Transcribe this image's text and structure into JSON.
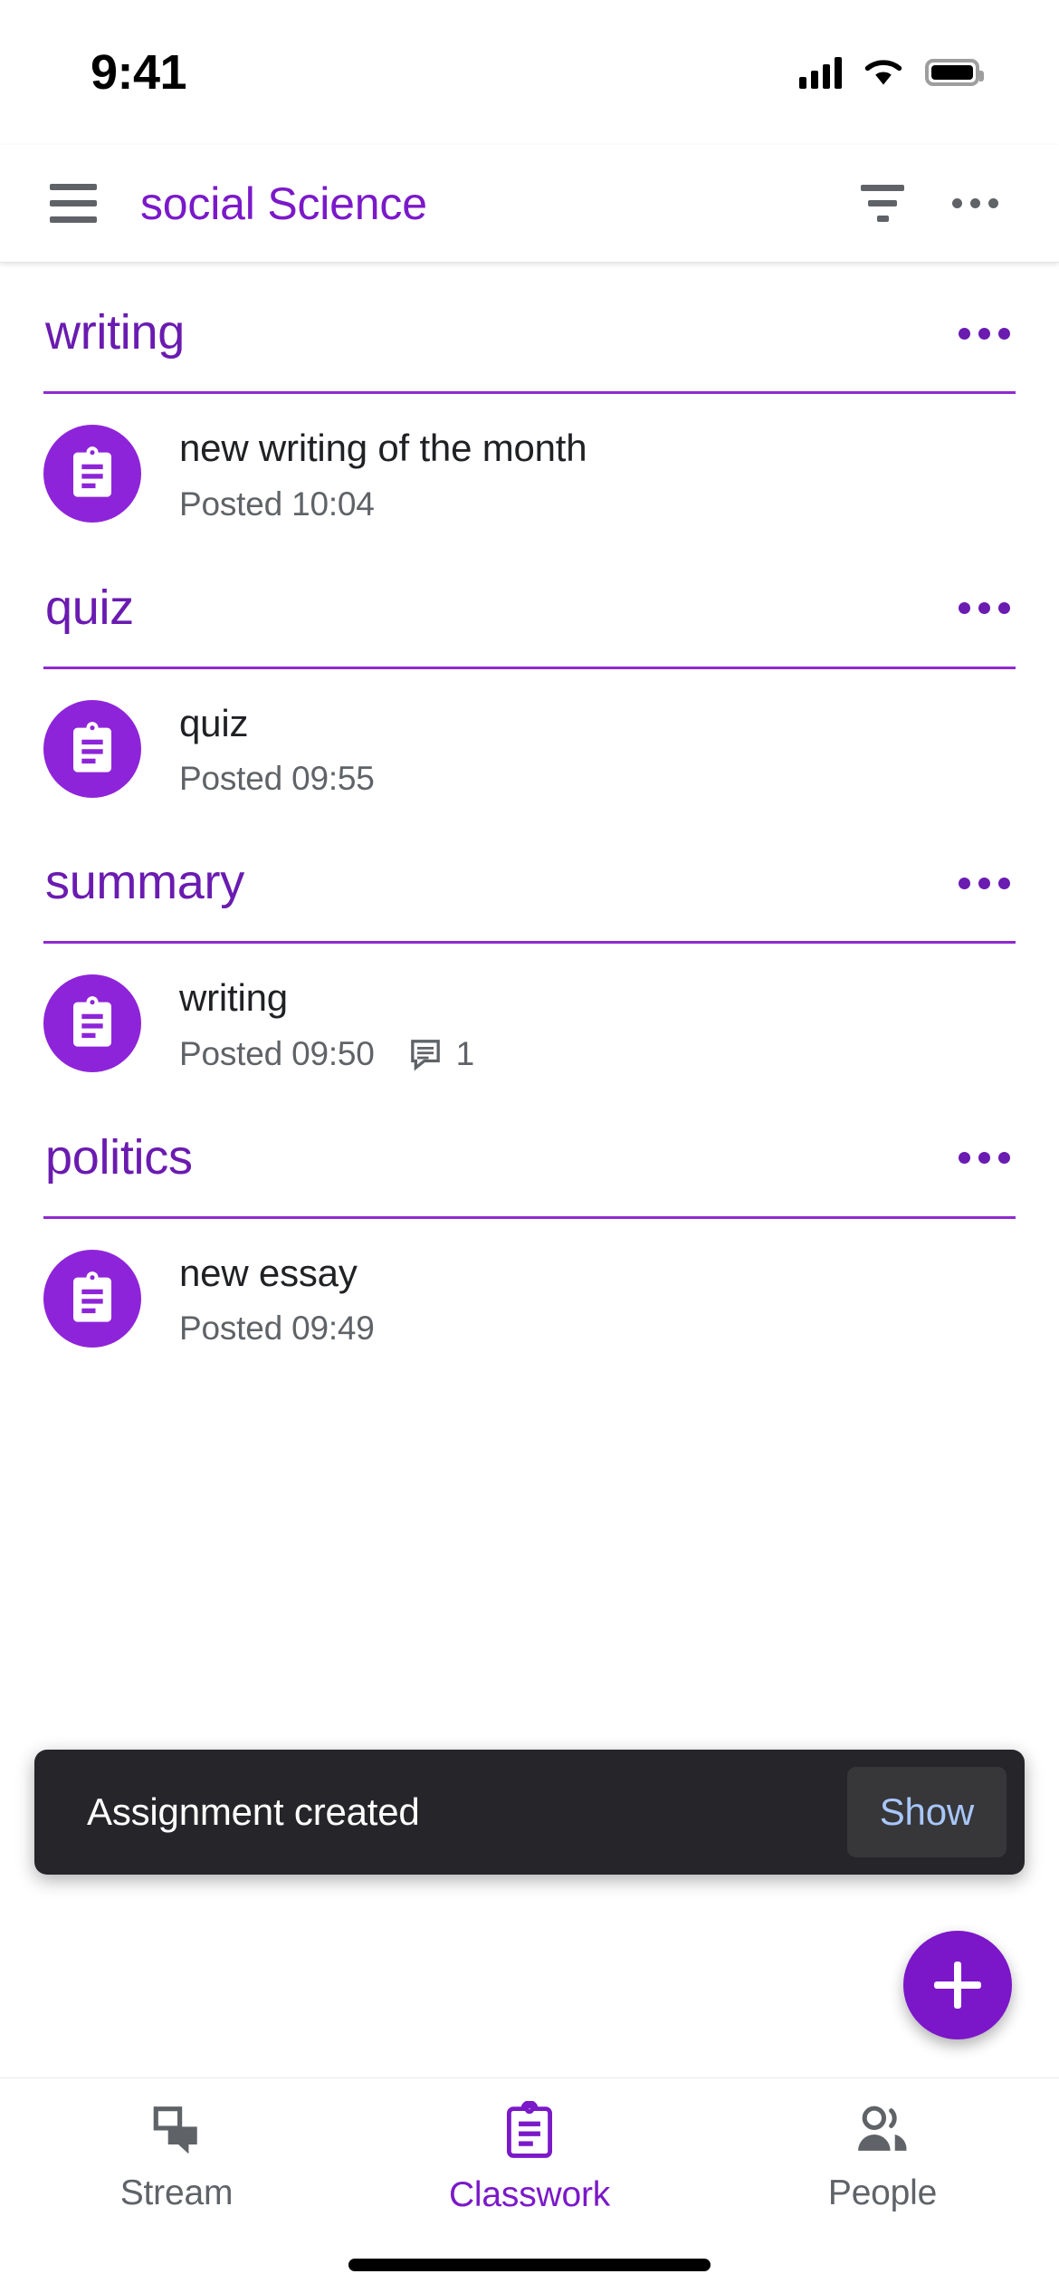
{
  "status_bar": {
    "time": "9:41",
    "signal_icon": "cellular-signal-icon",
    "wifi_icon": "wifi-icon",
    "battery_icon": "battery-icon"
  },
  "toolbar": {
    "menu_icon": "hamburger-menu-icon",
    "title": "social Science",
    "filter_icon": "filter-list-icon",
    "overflow_icon": "more-options-icon",
    "title_color": "#7B19C9"
  },
  "topics": [
    {
      "title": "writing",
      "menu_icon": "more-options-icon",
      "items": [
        {
          "icon": "assignment-clipboard-icon",
          "title": "new writing of the month",
          "posted": "Posted 10:04",
          "comments": null
        }
      ]
    },
    {
      "title": "quiz",
      "menu_icon": "more-options-icon",
      "items": [
        {
          "icon": "assignment-clipboard-icon",
          "title": "quiz",
          "posted": "Posted 09:55",
          "comments": null
        }
      ]
    },
    {
      "title": "summary",
      "menu_icon": "more-options-icon",
      "items": [
        {
          "icon": "assignment-clipboard-icon",
          "title": "writing",
          "posted": "Posted 09:50",
          "comments": "1",
          "comment_icon": "comment-bubble-icon"
        }
      ]
    },
    {
      "title": "politics",
      "menu_icon": "more-options-icon",
      "items": [
        {
          "icon": "assignment-clipboard-icon",
          "title": "new essay",
          "posted": "Posted 09:49",
          "comments": null
        }
      ]
    }
  ],
  "snackbar": {
    "message": "Assignment created",
    "action_label": "Show",
    "background_color": "#262529",
    "action_color": "#A8C7FA"
  },
  "fab": {
    "icon": "plus-icon",
    "color": "#7B16C9"
  },
  "bottom_nav": {
    "items": [
      {
        "label": "Stream",
        "icon": "stream-chat-icon",
        "active": false
      },
      {
        "label": "Classwork",
        "icon": "classwork-clipboard-icon",
        "active": true
      },
      {
        "label": "People",
        "icon": "people-icon",
        "active": false
      }
    ],
    "active_color": "#7B19C9",
    "inactive_color": "#5f6368"
  },
  "accent_colors": {
    "topic_title": "#6A1BB0",
    "topic_rule": "#8E2BD0",
    "assignment_avatar": "#8E24D9"
  }
}
